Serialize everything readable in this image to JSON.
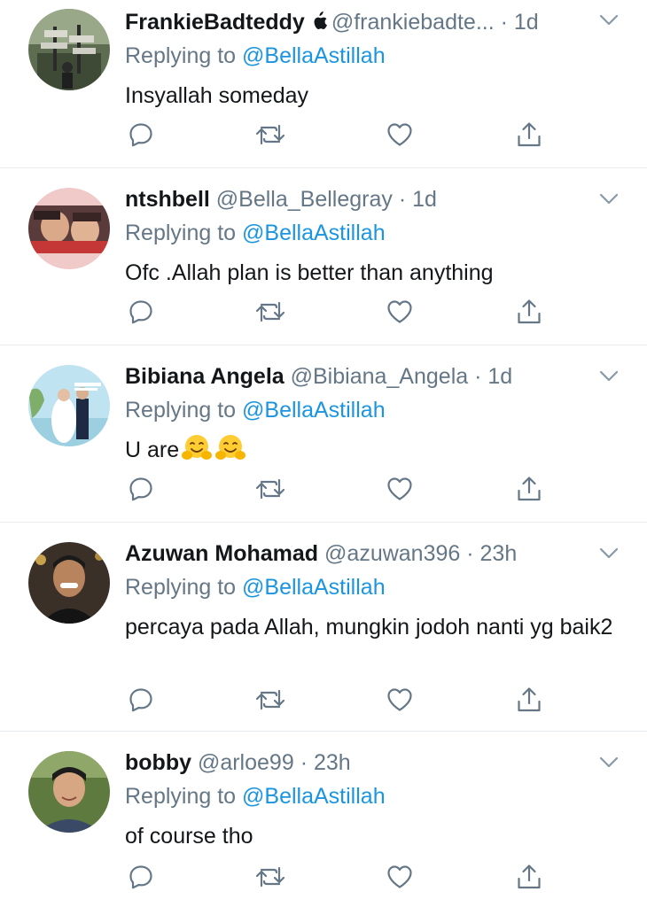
{
  "replies": [
    {
      "name": "FrankieBadteddy",
      "handle": "@frankiebadte...",
      "time": "· 1d",
      "replying_prefix": "Replying to ",
      "replying_to": "@BellaAstillah",
      "text": "Insyallah someday"
    },
    {
      "name": "ntshbell",
      "handle": "@Bella_Bellegray",
      "time": "· 1d",
      "replying_prefix": "Replying to ",
      "replying_to": "@BellaAstillah",
      "text": "Ofc .Allah plan is better than anything"
    },
    {
      "name": "Bibiana Angela",
      "handle": "@Bibiana_Angela",
      "time": "· 1d",
      "replying_prefix": "Replying to ",
      "replying_to": "@BellaAstillah",
      "text": "U are"
    },
    {
      "name": "Azuwan Mohamad",
      "handle": "@azuwan396",
      "time": "· 23h",
      "replying_prefix": "Replying to ",
      "replying_to": "@BellaAstillah",
      "text": "percaya pada Allah, mungkin jodoh nanti yg baik2"
    },
    {
      "name": "bobby",
      "handle": "@arloe99",
      "time": "· 23h",
      "replying_prefix": "Replying to ",
      "replying_to": "@BellaAstillah",
      "text": "of course tho"
    }
  ],
  "colors": {
    "accent": "#1b95e0",
    "secondary_text": "#657786",
    "divider": "#e6ecf0",
    "icon": "#657786"
  },
  "icons": [
    "reply-icon",
    "retweet-icon",
    "like-icon",
    "share-icon",
    "chevron-down-icon",
    "apple-logo-icon",
    "hugging-face-emoji"
  ]
}
